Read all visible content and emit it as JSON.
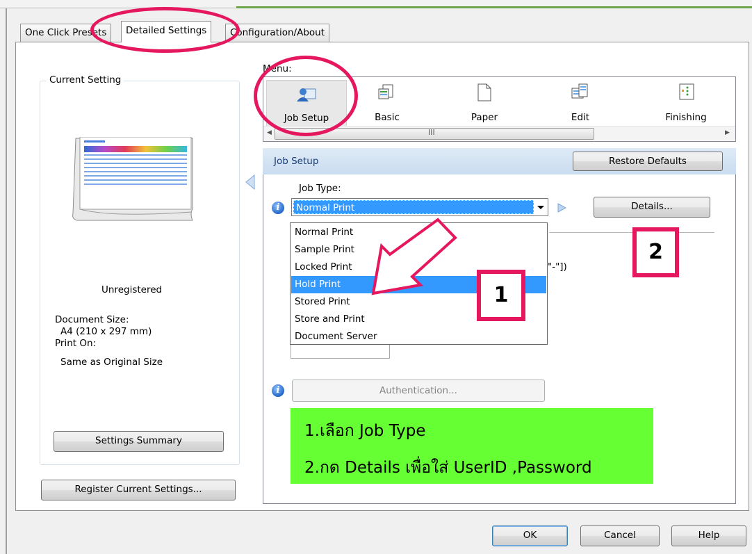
{
  "tabs": [
    {
      "label": "One Click Presets"
    },
    {
      "label": "Detailed Settings"
    },
    {
      "label": "Configuration/About"
    }
  ],
  "left_panel": {
    "group_title": "Current Setting",
    "registration": "Unregistered",
    "document_size_label": "Document Size:",
    "document_size_value": "A4 (210 x 297 mm)",
    "print_on_label": "Print On:",
    "print_on_value": "Same as Original Size",
    "summary_button": "Settings Summary",
    "register_button": "Register Current Settings..."
  },
  "menu": {
    "label": "Menu:",
    "items": [
      {
        "label": "Job Setup",
        "icon": "job-setup-icon",
        "selected": true
      },
      {
        "label": "Basic",
        "icon": "basic-icon"
      },
      {
        "label": "Paper",
        "icon": "paper-icon"
      },
      {
        "label": "Edit",
        "icon": "edit-icon"
      },
      {
        "label": "Finishing",
        "icon": "finishing-icon"
      }
    ],
    "scroll_grip": "III"
  },
  "job_setup": {
    "header": "Job Setup",
    "restore_button": "Restore Defaults",
    "job_type_label": "Job Type:",
    "job_type_value": "Normal Print",
    "details_button": "Details...",
    "options": [
      "Normal Print",
      "Sample Print",
      "Locked Print",
      "Hold Print",
      "Stored Print",
      "Store and Print",
      "Document Server"
    ],
    "highlighted_option": "Hold Print",
    "partial_text": "\"-\"])",
    "auth_button": "Authentication..."
  },
  "annotations": {
    "marker_1": "1",
    "marker_2": "2",
    "note_line_1": "1.เลือก Job Type",
    "note_line_2": "2.กด Details เพื่อใส่ UserID ,Password"
  },
  "footer": {
    "ok": "OK",
    "cancel": "Cancel",
    "help": "Help"
  },
  "colors": {
    "annotation": "#e5185f",
    "note_bg": "#66ff33",
    "selection": "#3399ff"
  }
}
